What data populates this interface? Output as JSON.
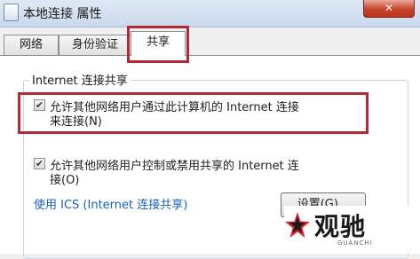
{
  "window": {
    "title": "本地连接 属性",
    "close_glyph": "✕"
  },
  "tabs": [
    {
      "label": "网络"
    },
    {
      "label": "身份验证"
    },
    {
      "label": "共享"
    }
  ],
  "sharing": {
    "group_label": "Internet 连接共享",
    "option1": {
      "checked": true,
      "line1": "允许其他网络用户通过此计算机的 Internet 连接",
      "line2": "来连接(N)"
    },
    "option2": {
      "checked": true,
      "line1": "允许其他网络用户控制或禁用共享的 Internet 连",
      "line2": "接(O)"
    },
    "ics_link": "使用 ICS (Internet 连接共享)",
    "settings_button": "设置(G)..."
  },
  "watermark": {
    "text": "观驰",
    "sub": "GUANCHI"
  },
  "colors": {
    "highlight": "#b32a37",
    "link": "#1a5fb4"
  }
}
